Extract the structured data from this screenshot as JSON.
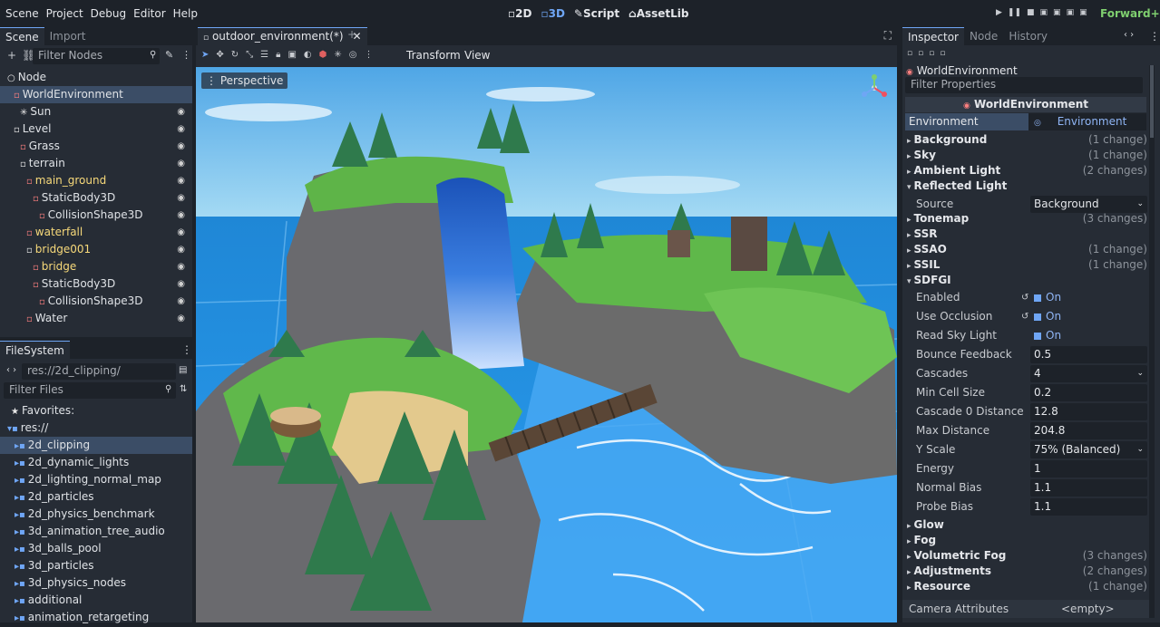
{
  "menu": [
    "Scene",
    "Project",
    "Debug",
    "Editor",
    "Help"
  ],
  "workspaces": {
    "d2": "2D",
    "d3": "3D",
    "script": "Script",
    "assetlib": "AssetLib"
  },
  "renderer": "Forward+",
  "scene_dock": {
    "tabs": [
      "Scene",
      "Import"
    ],
    "filter_placeholder": "Filter Nodes",
    "nodes": [
      {
        "label": "Node",
        "indent": 0,
        "icon": "node-icon"
      },
      {
        "label": "WorldEnvironment",
        "indent": 1,
        "icon": "world-environment-icon",
        "selected": true
      },
      {
        "label": "Sun",
        "indent": 2,
        "icon": "sun-icon"
      },
      {
        "label": "Level",
        "indent": 1,
        "icon": "node3d-icon"
      },
      {
        "label": "Grass",
        "indent": 2,
        "icon": "mesh-icon"
      },
      {
        "label": "terrain",
        "indent": 2,
        "icon": "node3d-icon"
      },
      {
        "label": "main_ground",
        "indent": 3,
        "icon": "mesh-icon",
        "highlight": true
      },
      {
        "label": "StaticBody3D",
        "indent": 4,
        "icon": "staticbody-icon"
      },
      {
        "label": "CollisionShape3D",
        "indent": 5,
        "icon": "collision-icon"
      },
      {
        "label": "waterfall",
        "indent": 3,
        "icon": "mesh-icon",
        "highlight": true
      },
      {
        "label": "bridge001",
        "indent": 3,
        "icon": "node3d-icon",
        "highlight": true
      },
      {
        "label": "bridge",
        "indent": 4,
        "icon": "mesh-icon",
        "highlight": true
      },
      {
        "label": "StaticBody3D",
        "indent": 4,
        "icon": "staticbody-icon"
      },
      {
        "label": "CollisionShape3D",
        "indent": 5,
        "icon": "collision-icon"
      },
      {
        "label": "Water",
        "indent": 3,
        "icon": "mesh-icon"
      }
    ]
  },
  "filesystem": {
    "title": "FileSystem",
    "path": "res://2d_clipping/",
    "filter_placeholder": "Filter Files",
    "favorites": "Favorites:",
    "root": "res://",
    "folders": [
      "2d_clipping",
      "2d_dynamic_lights",
      "2d_lighting_normal_map",
      "2d_particles",
      "2d_physics_benchmark",
      "3d_animation_tree_audio",
      "3d_balls_pool",
      "3d_particles",
      "3d_physics_nodes",
      "additional",
      "animation_retargeting"
    ]
  },
  "viewport": {
    "tab_label": "outdoor_environment(*)",
    "menu_transform": "Transform",
    "menu_view": "View",
    "perspective_label": "Perspective"
  },
  "inspector": {
    "tabs": [
      "Inspector",
      "Node",
      "History"
    ],
    "object_name": "WorldEnvironment",
    "filter_placeholder": "Filter Properties",
    "header": "WorldEnvironment",
    "environment_label": "Environment",
    "environment_value": "Environment",
    "sections": [
      {
        "name": "Background",
        "changes": "(1 change)"
      },
      {
        "name": "Sky",
        "changes": "(1 change)"
      },
      {
        "name": "Ambient Light",
        "changes": "(2 changes)"
      },
      {
        "name": "Reflected Light",
        "changes": ""
      }
    ],
    "reflected_source": {
      "label": "Source",
      "value": "Background"
    },
    "sections2": [
      {
        "name": "Tonemap",
        "changes": "(3 changes)"
      },
      {
        "name": "SSR",
        "changes": ""
      },
      {
        "name": "SSAO",
        "changes": "(1 change)"
      },
      {
        "name": "SSIL",
        "changes": "(1 change)"
      },
      {
        "name": "SDFGI",
        "changes": ""
      }
    ],
    "sdfgi": [
      {
        "label": "Enabled",
        "value": "On"
      },
      {
        "label": "Use Occlusion",
        "value": "On"
      },
      {
        "label": "Read Sky Light",
        "value": "On"
      },
      {
        "label": "Bounce Feedback",
        "value": "0.5"
      },
      {
        "label": "Cascades",
        "value": "4"
      },
      {
        "label": "Min Cell Size",
        "value": "0.2"
      },
      {
        "label": "Cascade 0 Distance",
        "value": "12.8"
      },
      {
        "label": "Max Distance",
        "value": "204.8"
      },
      {
        "label": "Y Scale",
        "value": "75% (Balanced)"
      },
      {
        "label": "Energy",
        "value": "1"
      },
      {
        "label": "Normal Bias",
        "value": "1.1"
      },
      {
        "label": "Probe Bias",
        "value": "1.1"
      }
    ],
    "sections3": [
      {
        "name": "Glow",
        "changes": ""
      },
      {
        "name": "Fog",
        "changes": ""
      },
      {
        "name": "Volumetric Fog",
        "changes": "(3 changes)"
      },
      {
        "name": "Adjustments",
        "changes": "(2 changes)"
      },
      {
        "name": "Resource",
        "changes": "(1 change)"
      }
    ],
    "camera_attributes": {
      "label": "Camera Attributes",
      "value": "<empty>"
    }
  }
}
